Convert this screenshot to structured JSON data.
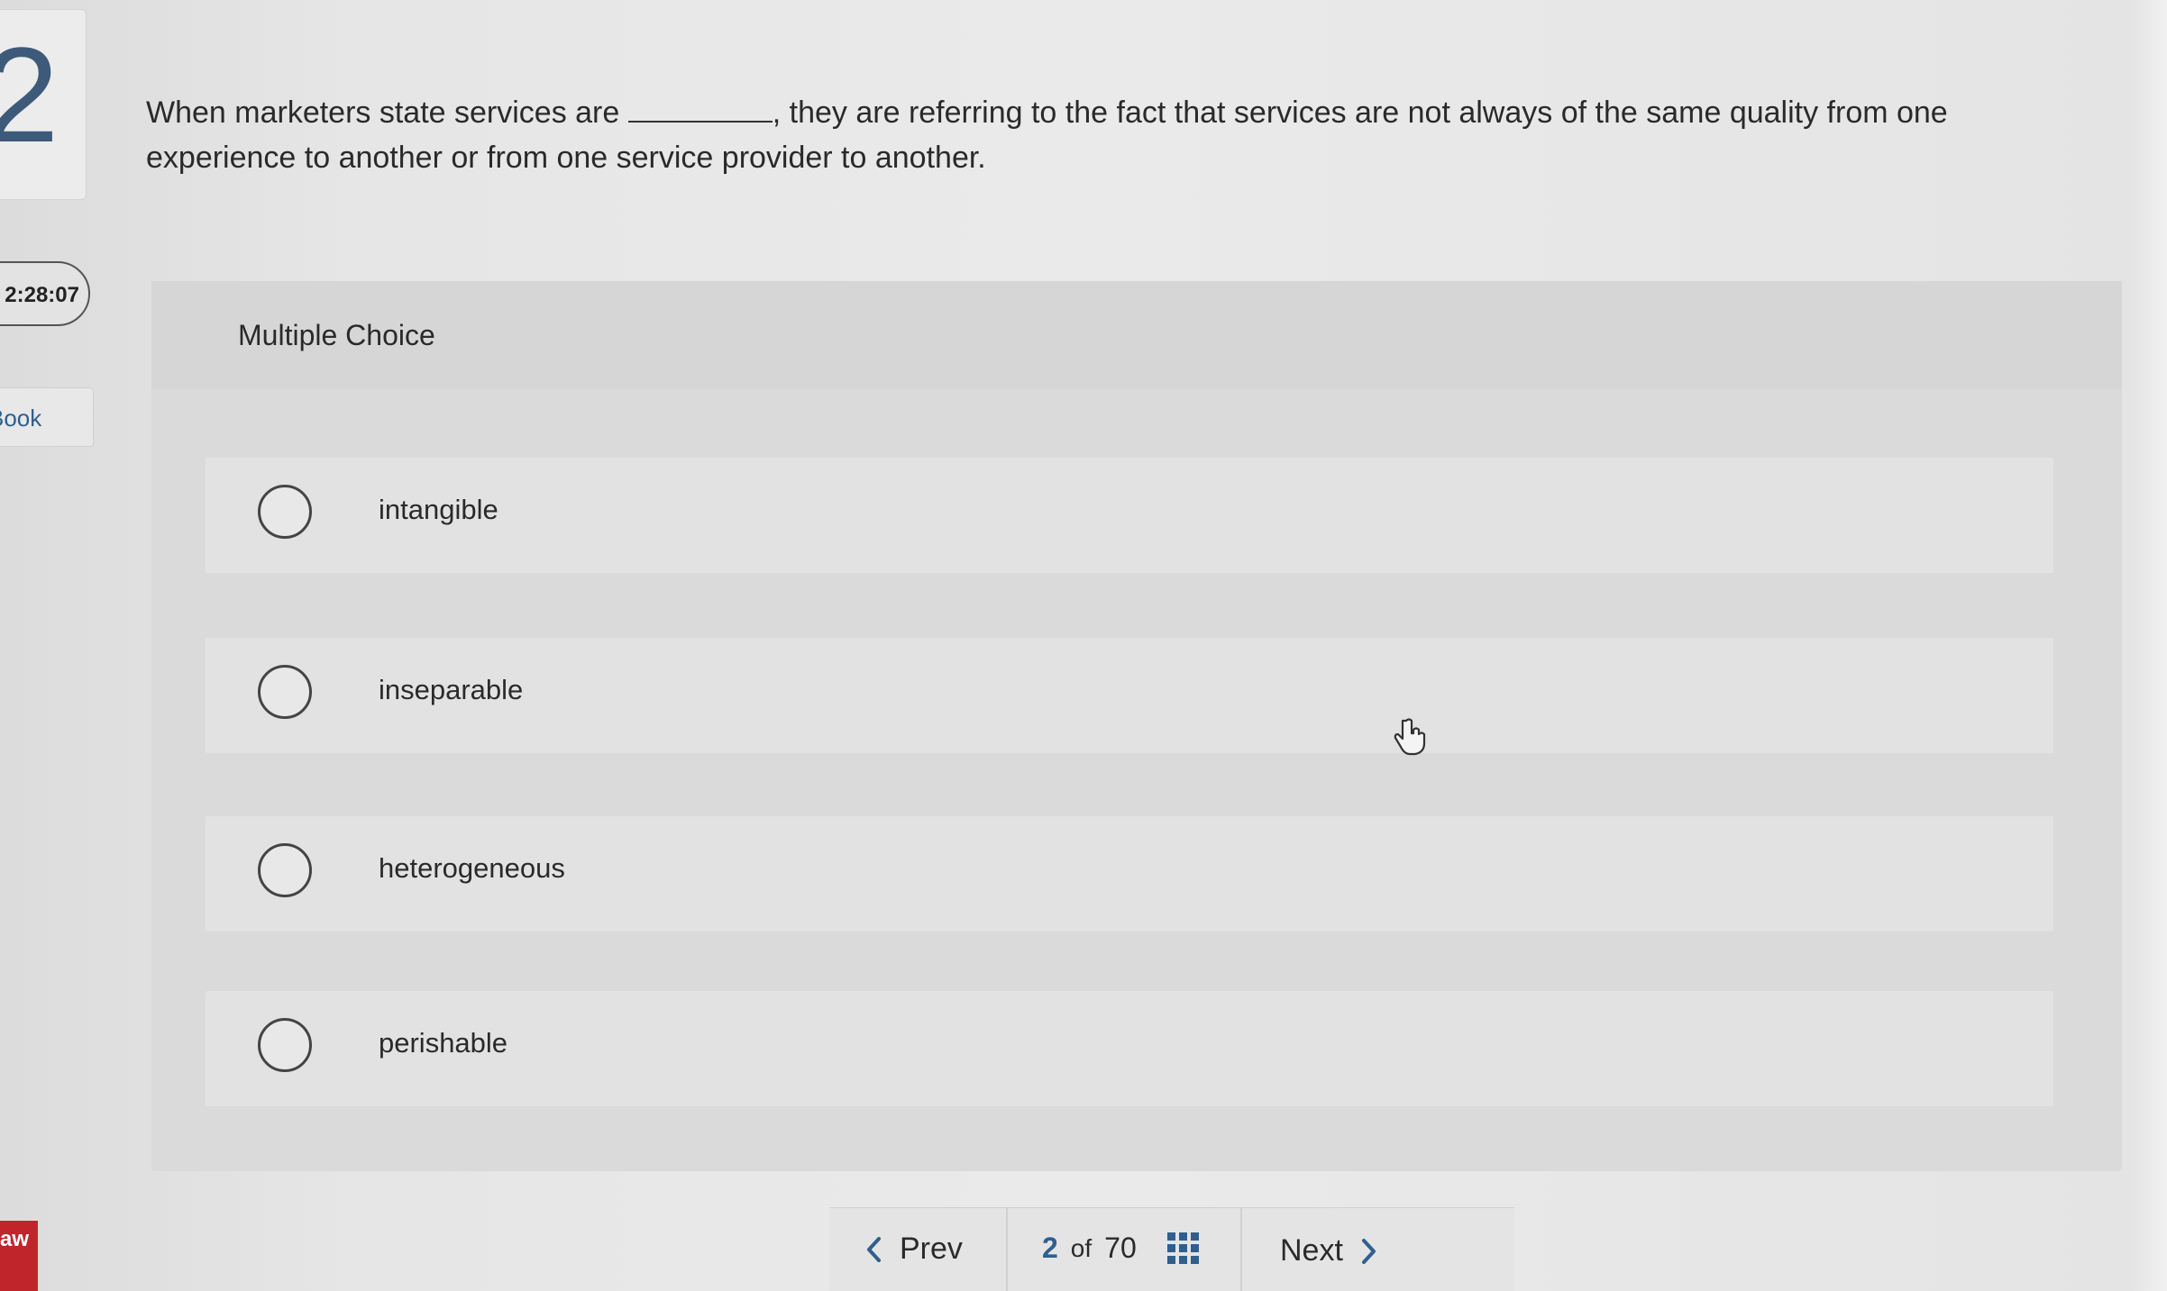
{
  "sidebar": {
    "question_number": "2",
    "timer": "2:28:07",
    "ebook_label": "Book",
    "brand_badge": "aw"
  },
  "question": {
    "text_before": "When marketers state services are ",
    "text_after": ", they are referring to the fact that services are not always of the same quality from one experience to another or from one service provider to another."
  },
  "multiple_choice": {
    "title": "Multiple Choice",
    "options": [
      {
        "label": "intangible",
        "selected": false
      },
      {
        "label": "inseparable",
        "selected": false
      },
      {
        "label": "heterogeneous",
        "selected": false
      },
      {
        "label": "perishable",
        "selected": false
      }
    ]
  },
  "navigation": {
    "prev_label": "Prev",
    "current_page": "2",
    "of_label": "of",
    "total_pages": "70",
    "next_label": "Next"
  },
  "colors": {
    "accent": "#2f5f8f",
    "brand": "#c0252b"
  },
  "icons": {
    "prev": "chevron-left-icon",
    "next": "chevron-right-icon",
    "grid": "grid-icon",
    "cursor": "hand-pointer-icon"
  }
}
